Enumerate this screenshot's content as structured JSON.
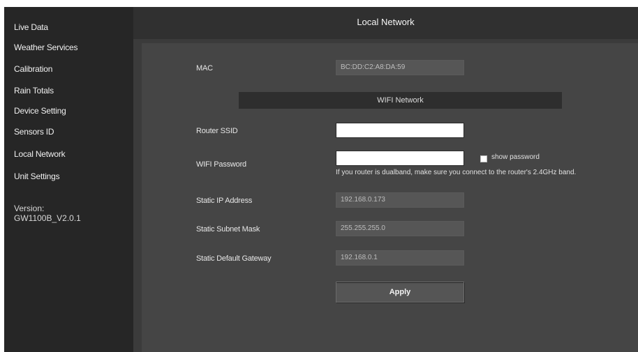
{
  "sidebar": {
    "items": [
      {
        "label": "Live Data"
      },
      {
        "label": "Weather Services"
      },
      {
        "label": "Calibration"
      },
      {
        "label": "Rain Totals"
      },
      {
        "label": "Device Setting"
      },
      {
        "label": "Sensors ID"
      },
      {
        "label": "Local Network"
      },
      {
        "label": "Unit Settings"
      }
    ],
    "version_label": "Version:",
    "version_value": "GW1100B_V2.0.1"
  },
  "header": {
    "title": "Local Network"
  },
  "form": {
    "mac_label": "MAC",
    "mac_value": "BC:DD:C2:A8:DA:59",
    "wifi_section": "WIFI Network",
    "ssid_label": "Router SSID",
    "ssid_value": "",
    "password_label": "WIFI Password",
    "password_value": "",
    "show_password_label": "show password",
    "dualband_hint": "If you router is dualband, make sure you connect to the router's 2.4GHz band.",
    "static_ip_label": "Static IP Address",
    "static_ip_value": "192.168.0.173",
    "subnet_label": "Static Subnet Mask",
    "subnet_value": "255.255.255.0",
    "gateway_label": "Static Default Gateway",
    "gateway_value": "192.168.0.1",
    "apply_label": "Apply"
  },
  "colors": {
    "sidebar_bg": "#262626",
    "topbar_bg": "#303030",
    "content_bg": "#454545"
  }
}
